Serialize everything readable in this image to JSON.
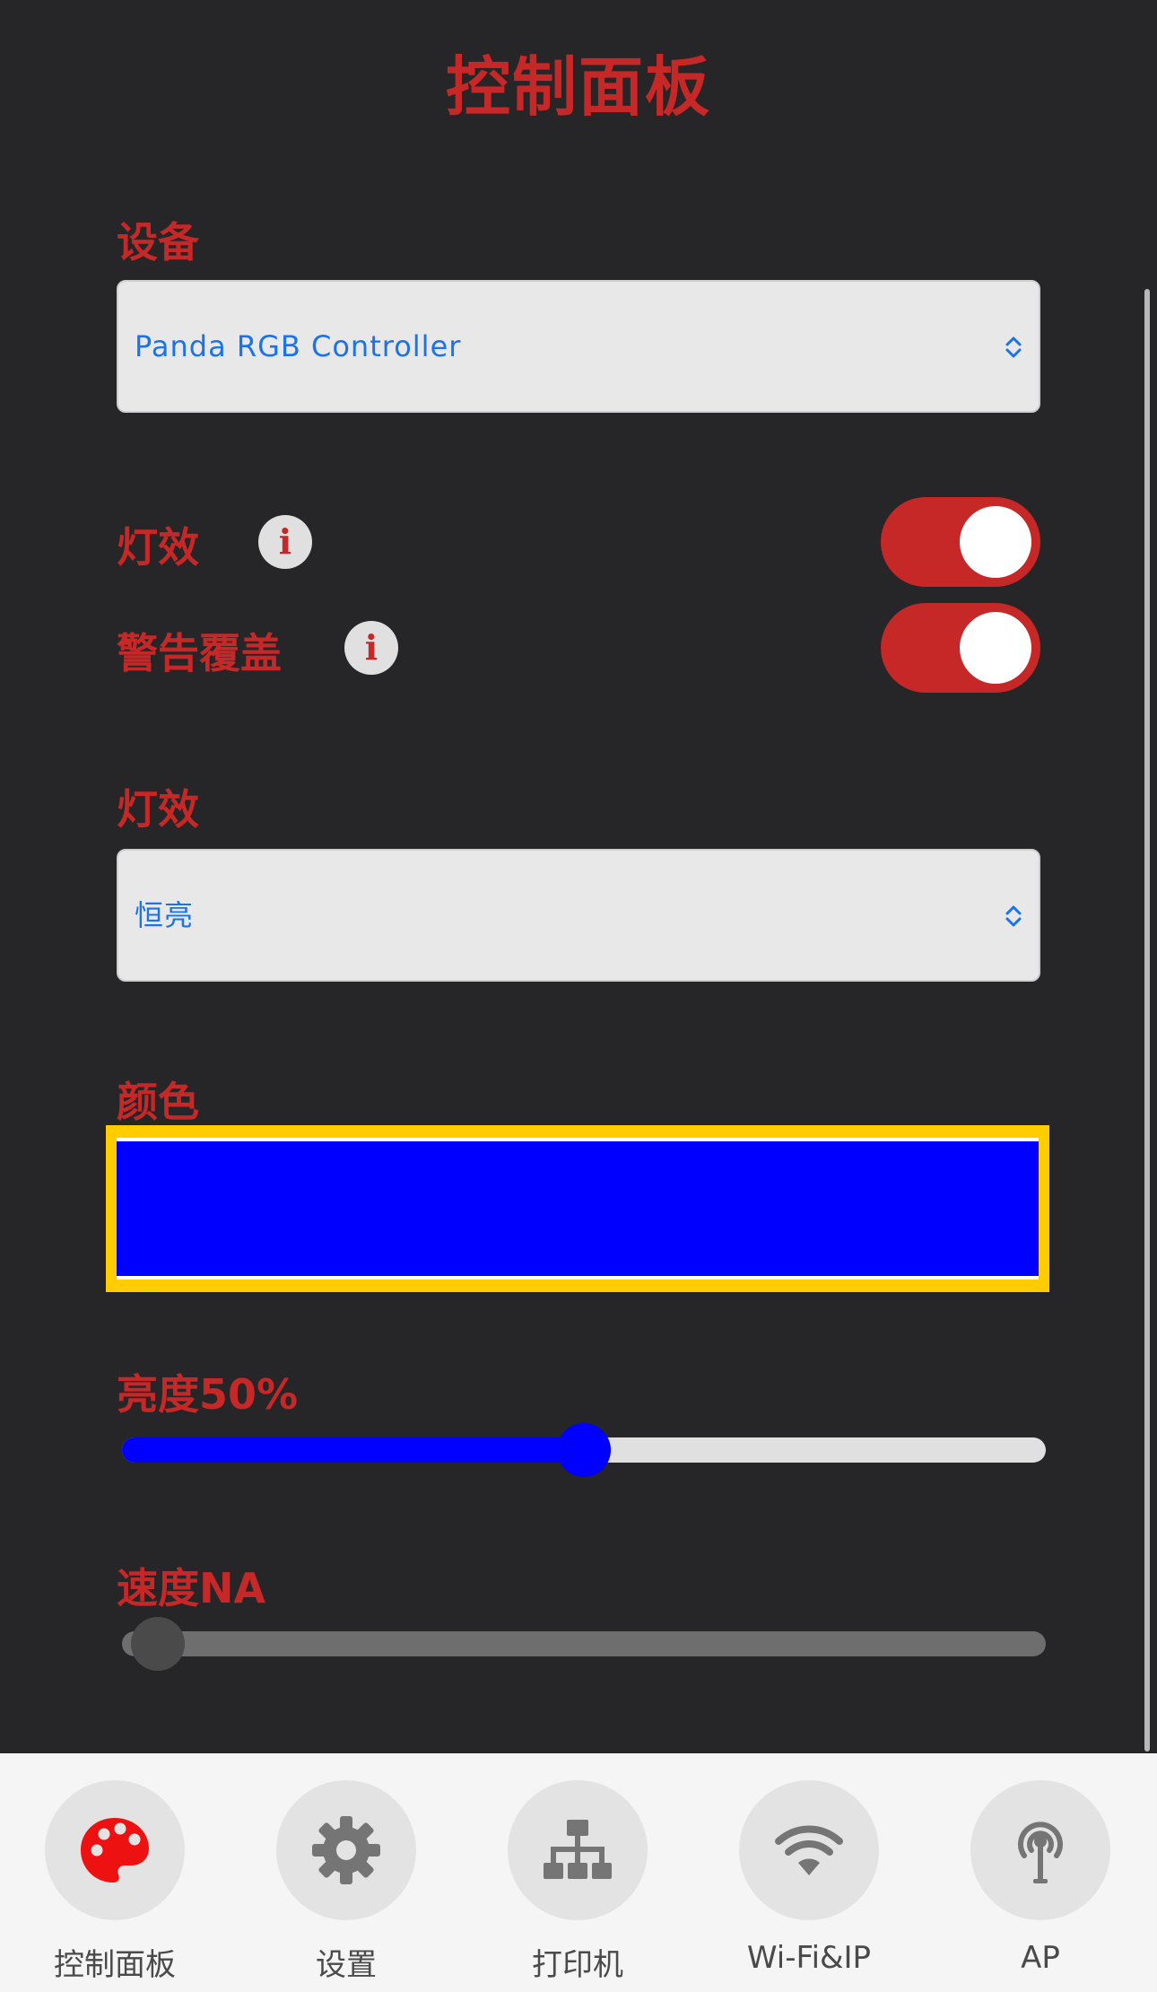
{
  "header": {
    "title": "控制面板"
  },
  "device": {
    "label": "设备",
    "selected": "Panda RGB Controller"
  },
  "toggles": [
    {
      "label": "灯效",
      "info_icon": "i",
      "on": true
    },
    {
      "label": "警告覆盖",
      "info_icon": "i",
      "on": true
    }
  ],
  "effect": {
    "label": "灯效",
    "selected": "恒亮"
  },
  "color": {
    "label": "颜色",
    "value": "#0000ff"
  },
  "brightness": {
    "label": "亮度50%",
    "value_percent": 50,
    "fill_color": "#0000ff"
  },
  "speed": {
    "label": "速度NA",
    "value_percent": 0,
    "disabled": true
  },
  "tabbar": {
    "tabs": [
      {
        "label": "控制面板",
        "icon": "palette-icon",
        "active": true
      },
      {
        "label": "设置",
        "icon": "gear-icon",
        "active": false
      },
      {
        "label": "打印机",
        "icon": "network-tree-icon",
        "active": false
      },
      {
        "label": "Wi-Fi&IP",
        "icon": "wifi-icon",
        "active": false
      },
      {
        "label": "AP",
        "icon": "antenna-icon",
        "active": false
      }
    ]
  },
  "colors": {
    "accent": "#c62828",
    "background": "#262527",
    "select_text": "#1a73e8",
    "highlight_border": "#ffcc00"
  }
}
